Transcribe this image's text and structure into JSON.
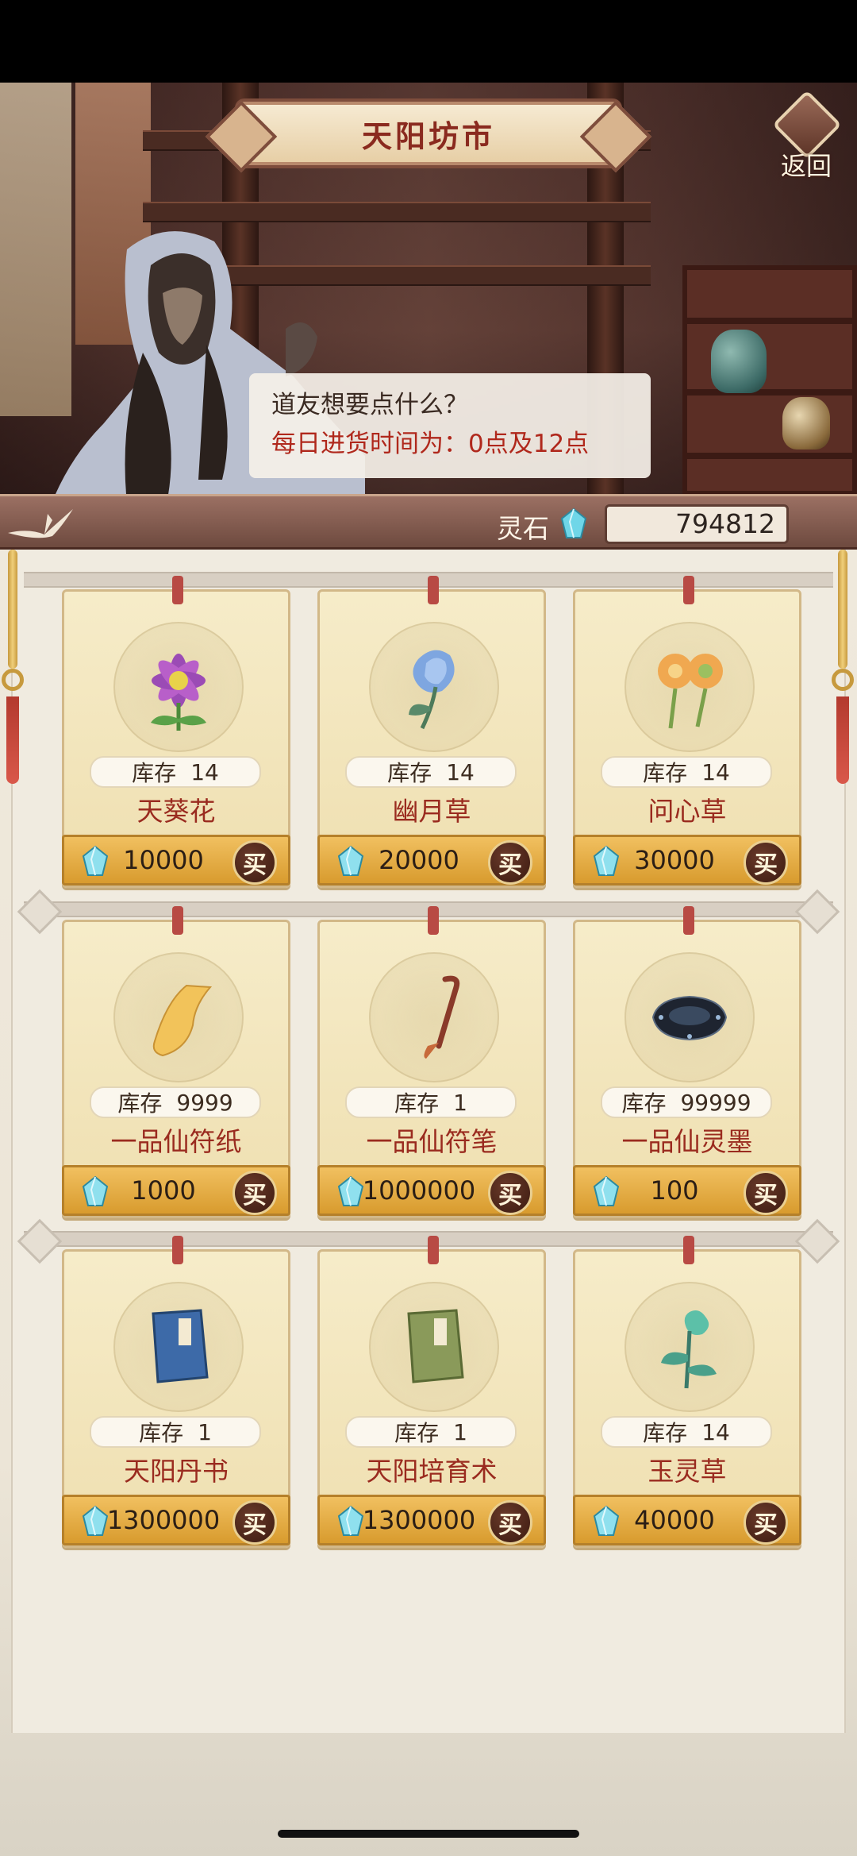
{
  "header": {
    "title": "天阳坊市",
    "back_label": "返回"
  },
  "dialog": {
    "line1": "道友想要点什么？",
    "line2": "每日进货时间为：0点及12点"
  },
  "currency": {
    "label": "灵石",
    "amount": "794812",
    "icon": "spirit-stone-icon",
    "color": "#6fd6e8"
  },
  "shop": {
    "stock_label": "库存",
    "buy_label": "买",
    "items": [
      {
        "name": "天葵花",
        "stock": "14",
        "price": "10000",
        "icon": "purple-flower-icon"
      },
      {
        "name": "幽月草",
        "stock": "14",
        "price": "20000",
        "icon": "blue-flower-icon"
      },
      {
        "name": "问心草",
        "stock": "14",
        "price": "30000",
        "icon": "orange-flower-icon"
      },
      {
        "name": "一品仙符纸",
        "stock": "9999",
        "price": "1000",
        "icon": "talisman-paper-icon"
      },
      {
        "name": "一品仙符笔",
        "stock": "1",
        "price": "1000000",
        "icon": "brush-icon"
      },
      {
        "name": "一品仙灵墨",
        "stock": "99999",
        "price": "100",
        "icon": "inkstone-icon"
      },
      {
        "name": "天阳丹书",
        "stock": "1",
        "price": "1300000",
        "icon": "blue-book-icon"
      },
      {
        "name": "天阳培育术",
        "stock": "1",
        "price": "1300000",
        "icon": "green-book-icon"
      },
      {
        "name": "玉灵草",
        "stock": "14",
        "price": "40000",
        "icon": "jade-herb-icon"
      }
    ]
  }
}
